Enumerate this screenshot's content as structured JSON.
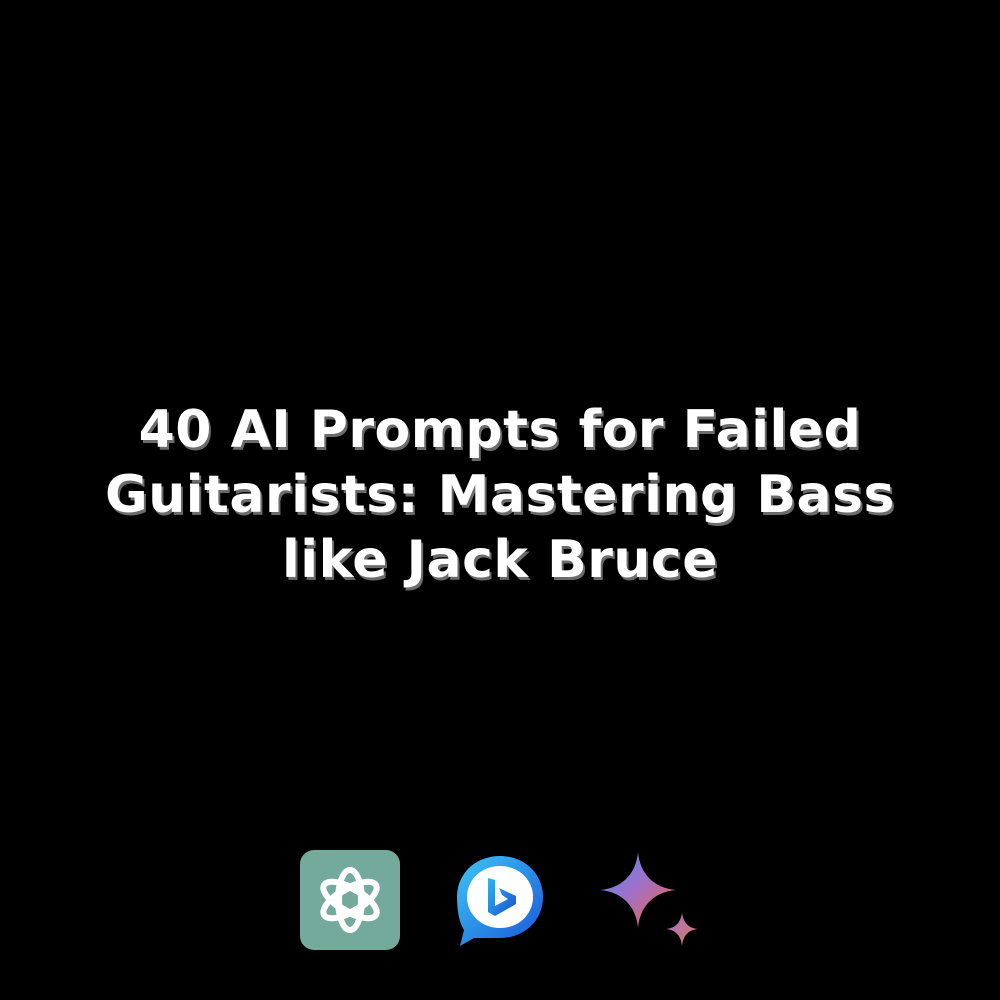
{
  "title": {
    "lines": [
      "40 AI Prompts for Failed",
      "Guitarists: Mastering Bass",
      "like Jack Bruce"
    ]
  },
  "logos": [
    {
      "icon": "chatgpt-icon",
      "color": "#74aa9c"
    },
    {
      "icon": "bing-chat-icon",
      "color": "#1c8cf0"
    },
    {
      "icon": "gemini-sparkle-icon",
      "color": "#9b72cb"
    }
  ],
  "colors": {
    "background": "#000000",
    "text": "#ffffff"
  }
}
